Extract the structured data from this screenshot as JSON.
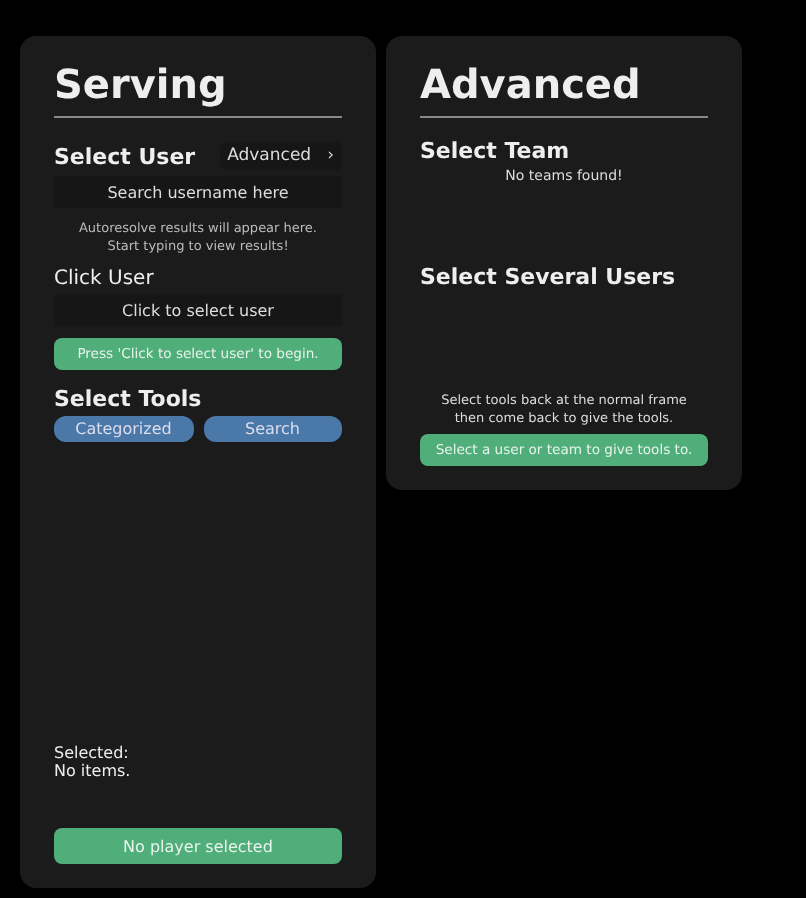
{
  "serving": {
    "title": "Serving",
    "select_user": {
      "label": "Select User",
      "advanced_button": "Advanced",
      "advanced_chevron": "›",
      "search": {
        "placeholder": "Search username here"
      },
      "hint": "Autoresolve results will appear here.\nStart typing to view results!"
    },
    "click_user": {
      "label": "Click User",
      "button": "Click to select user",
      "prompt": "Press 'Click to select user' to begin."
    },
    "select_tools": {
      "label": "Select Tools",
      "tabs": [
        {
          "label": "Categorized",
          "selected": false
        },
        {
          "label": "Search",
          "selected": false
        }
      ]
    },
    "selected_label": "Selected:",
    "selected_value": "No items.",
    "action_button": "No player selected"
  },
  "advanced": {
    "title": "Advanced",
    "select_team": "Select Team",
    "teams_empty": "No teams found!",
    "select_several": "Select Several Users",
    "note": "Select tools back at the normal frame\nthen come back to give the tools.",
    "action_button": "Select a user or team to give tools to."
  }
}
